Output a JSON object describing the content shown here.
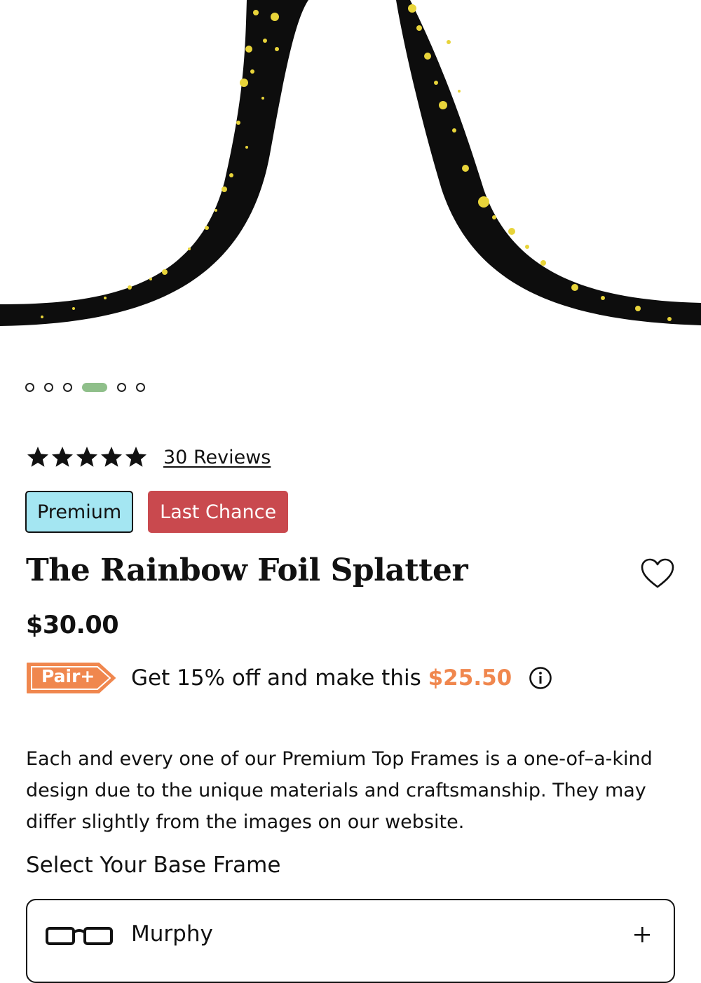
{
  "gallery": {
    "image_alt": "",
    "dots": [
      {
        "active": false
      },
      {
        "active": false
      },
      {
        "active": false
      },
      {
        "active": true
      },
      {
        "active": false
      },
      {
        "active": false
      }
    ]
  },
  "rating": {
    "stars": 5,
    "reviews_label": "30 Reviews"
  },
  "badges": {
    "premium": "Premium",
    "last_chance": "Last Chance"
  },
  "product": {
    "title": "The Rainbow Foil Splatter",
    "price": "$30.00"
  },
  "promo": {
    "tag_label": "Pair+",
    "text": "Get 15% off and make this ",
    "discount_price": "$25.50",
    "accent_color": "#f0874e"
  },
  "description": "Each and every one of our Premium Top Frames is a one-of–a-kind design due to the unique materials and craftsmanship. They may differ slightly from the images on our website.",
  "base_frame": {
    "heading": "Select Your Base Frame",
    "selected_name": "Murphy"
  },
  "colors": {
    "badge_premium_bg": "#a4e6f2",
    "badge_last_chance_bg": "#c9494e",
    "active_dot": "#8fbf8a",
    "frame_speckle": "#e8d43a"
  }
}
